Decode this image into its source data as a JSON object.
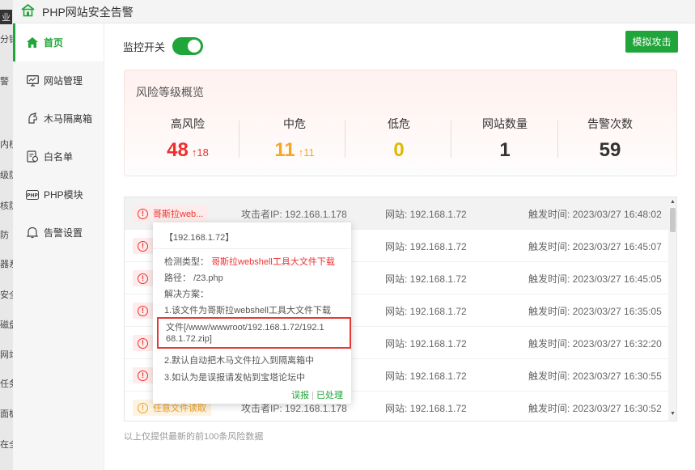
{
  "window": {
    "title": "PHP网站安全告警"
  },
  "background_fragments": [
    "业",
    "分钟",
    "警",
    "内核",
    "级防",
    "核防",
    "防",
    "器系",
    "安全",
    "磁盘",
    "网站",
    "任务",
    "面板",
    "在全"
  ],
  "sidebar": {
    "items": [
      {
        "label": "首页",
        "icon": "home-icon",
        "active": true
      },
      {
        "label": "网站管理",
        "icon": "monitor-icon",
        "active": false
      },
      {
        "label": "木马隔离箱",
        "icon": "trojan-icon",
        "active": false
      },
      {
        "label": "白名单",
        "icon": "whitelist-icon",
        "active": false
      },
      {
        "label": "PHP模块",
        "icon": "php-icon",
        "active": false
      },
      {
        "label": "告警设置",
        "icon": "bell-icon",
        "active": false
      }
    ]
  },
  "header": {
    "monitor_label": "监控开关",
    "monitor_on": true,
    "simulate_button": "模拟攻击"
  },
  "overview": {
    "title": "风险等级概览",
    "stats": [
      {
        "label": "高风险",
        "value": "48",
        "delta": "↑18",
        "color": "#ef2f2f"
      },
      {
        "label": "中危",
        "value": "11",
        "delta": "↑11",
        "color": "#f5a623"
      },
      {
        "label": "低危",
        "value": "0",
        "delta": "",
        "color": "#e0b800"
      },
      {
        "label": "网站数量",
        "value": "1",
        "delta": "",
        "color": "#333333"
      },
      {
        "label": "告警次数",
        "value": "59",
        "delta": "",
        "color": "#333333"
      }
    ]
  },
  "alerts": [
    {
      "tag": "哥斯拉web...",
      "level": "high",
      "attacker": "攻击者IP: 192.168.1.178",
      "site": "网站: 192.168.1.72",
      "time": "触发时间: 2023/03/27 16:48:02"
    },
    {
      "tag": "",
      "level": "high",
      "attacker": "",
      "site": "网站: 192.168.1.72",
      "time": "触发时间: 2023/03/27 16:45:07"
    },
    {
      "tag": "",
      "level": "high",
      "attacker": "",
      "site": "网站: 192.168.1.72",
      "time": "触发时间: 2023/03/27 16:45:05"
    },
    {
      "tag": "",
      "level": "high",
      "attacker": "",
      "site": "网站: 192.168.1.72",
      "time": "触发时间: 2023/03/27 16:35:05"
    },
    {
      "tag": "",
      "level": "high",
      "attacker": "",
      "site": "网站: 192.168.1.72",
      "time": "触发时间: 2023/03/27 16:32:20"
    },
    {
      "tag": "",
      "level": "high",
      "attacker": "",
      "site": "网站: 192.168.1.72",
      "time": "触发时间: 2023/03/27 16:30:55"
    },
    {
      "tag": "任意文件读取",
      "level": "warn",
      "attacker": "攻击者IP: 192.168.1.178",
      "site": "网站: 192.168.1.72",
      "time": "触发时间: 2023/03/27 16:30:52"
    }
  ],
  "footnote": "以上仅提供最新的前100条风险数据",
  "popup": {
    "header": "【192.168.1.72】",
    "type_label": "检测类型：",
    "type_value": "哥斯拉webshell工具大文件下载",
    "path_label": "路径：",
    "path_value": "/23.php",
    "solution_label": "解决方案：",
    "step1": "1.该文件为哥斯拉webshell工具大文件下载",
    "file_line1": "文件[/www/wwwroot/192.168.1.72/192.1",
    "file_line2": "68.1.72.zip]",
    "step2": "2.默认自动把木马文件拉入到隔离箱中",
    "step3": "3.如认为是误报请发帖到宝塔论坛中",
    "false_positive": "误报",
    "handled": "已处理"
  }
}
